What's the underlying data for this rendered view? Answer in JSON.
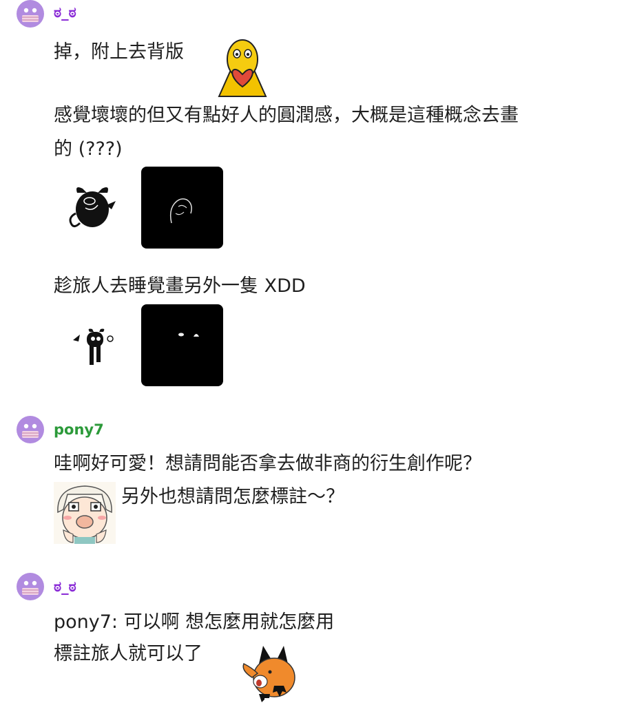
{
  "messages": [
    {
      "username": "ಠ_ಠ",
      "lines": [
        "掉，附上去背版",
        "感覺壞壞的但又有點好人的圓潤感，大概是這種概念去畫",
        "的 (???)",
        "趁旅人去睡覺畫另外一隻 XDD"
      ],
      "stickers": [
        "yellow-bird-holding-heart",
        "devil-bull-character",
        "devil-bull-on-black",
        "small-devil-character",
        "small-devil-eyes-on-black"
      ]
    },
    {
      "username": "pony7",
      "lines": [
        "哇啊好可愛！想請問能否拿去做非商的衍生創作呢？",
        "另外也想請問怎麼標註～？"
      ],
      "stickers": [
        "anime-girl-surprised"
      ]
    },
    {
      "username": "ಠ_ಠ",
      "lines": [
        "pony7: 可以啊 想怎麼用就怎麼用",
        "標註旅人就可以了"
      ],
      "stickers": [
        "fox-cheering"
      ]
    }
  ],
  "colors": {
    "username_purple": "#8a2bd6",
    "username_green": "#2c9a3a",
    "avatar": "#b18be0"
  }
}
